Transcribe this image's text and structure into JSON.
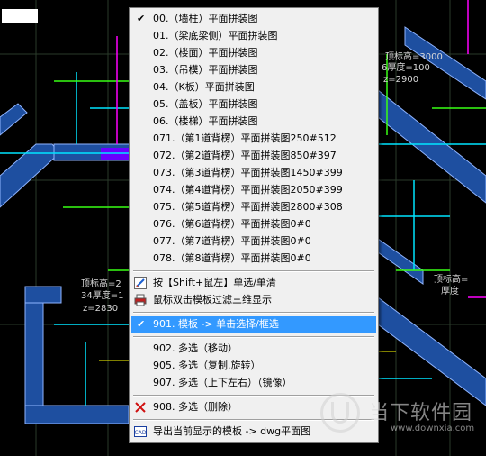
{
  "colors": {
    "canvas_bg": "#000000",
    "wall_blue": "#1e4fa0",
    "line_cyan": "#00e5ff",
    "line_green": "#39ff14",
    "line_magenta": "#ff00ff",
    "line_yellow": "#ffff00",
    "menu_bg": "#f0f0f0",
    "menu_highlight": "#3399ff"
  },
  "cad_labels": {
    "top_right_1": "顶标高=3000",
    "top_right_2": "6厚度=100",
    "top_right_3": "z=2900",
    "left_1": "顶标高=2",
    "left_2": "34厚度=1",
    "left_3": "z=2830",
    "right_mid_1": "顶标高=",
    "right_mid_2": "厚度"
  },
  "context_menu": {
    "items": [
      {
        "label": "00.（墙柱）平面拼装图",
        "checked": true
      },
      {
        "label": "01.（梁底梁侧）平面拼装图"
      },
      {
        "label": "02.（楼面）平面拼装图"
      },
      {
        "label": "03.（吊模）平面拼装图"
      },
      {
        "label": "04.（K板）平面拼装图"
      },
      {
        "label": "05.（盖板）平面拼装图"
      },
      {
        "label": "06.（楼梯）平面拼装图"
      },
      {
        "label": "071.（第1道背楞）平面拼装图250#512"
      },
      {
        "label": "072.（第2道背楞）平面拼装图850#397"
      },
      {
        "label": "073.（第3道背楞）平面拼装图1450#399"
      },
      {
        "label": "074.（第4道背楞）平面拼装图2050#399"
      },
      {
        "label": "075.（第5道背楞）平面拼装图2800#308"
      },
      {
        "label": "076.（第6道背楞）平面拼装图0#0"
      },
      {
        "label": "077.（第7道背楞）平面拼装图0#0"
      },
      {
        "label": "078.（第8道背楞）平面拼装图0#0"
      }
    ],
    "shift_select": "按【Shift+鼠左】单选/单清",
    "dblclick_filter": "鼠标双击模板过滤三维显示",
    "mode_901": "901. 模板 -> 单击选择/框选",
    "mode_902": "902. 多选（移动）",
    "mode_905": "905. 多选（复制.旋转）",
    "mode_907": "907. 多选（上下左右）（镜像）",
    "mode_908": "908. 多选（删除）",
    "export_dwg": "导出当前显示的模板 -> dwg平面图",
    "cad_icon_text": "CAD"
  },
  "watermark": {
    "name": "当下软件园",
    "url": "www.downxia.com"
  }
}
